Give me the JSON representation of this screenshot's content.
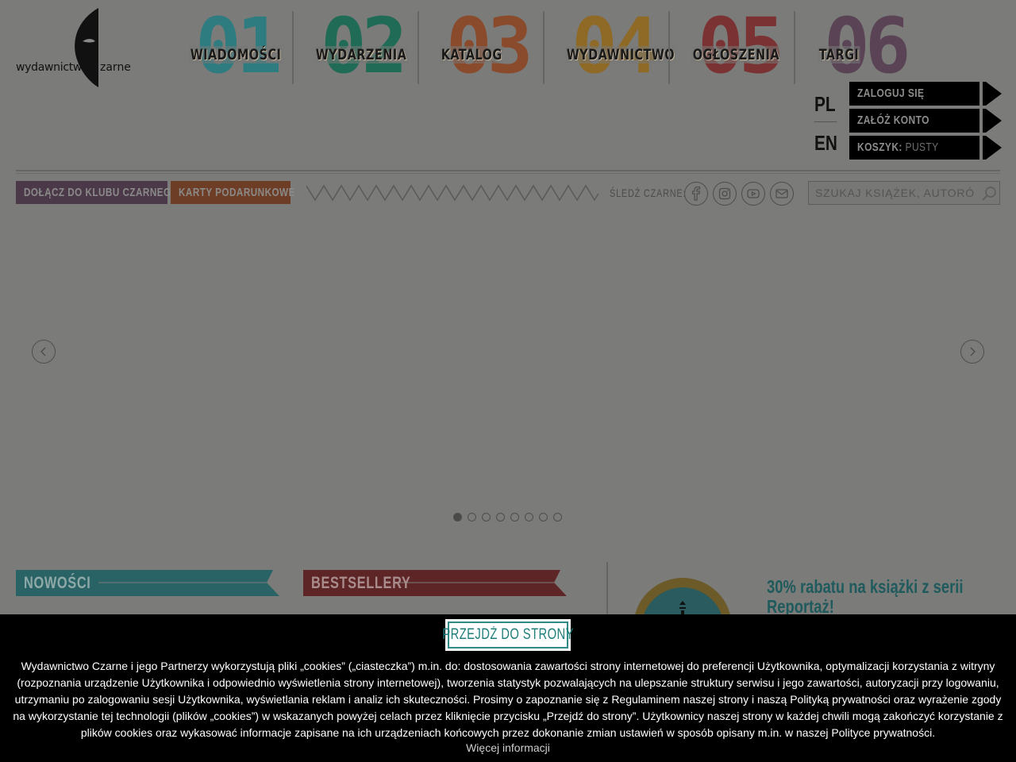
{
  "logo": {
    "text_left": "wydawnictwo",
    "text_right": "zarne"
  },
  "nav": [
    {
      "num": "01",
      "label": "WIADOMOŚCI",
      "color": "#2e7c80"
    },
    {
      "num": "02",
      "label": "WYDARZENIA",
      "color": "#1f6b55"
    },
    {
      "num": "03",
      "label": "KATALOG",
      "color": "#8a4a2c"
    },
    {
      "num": "04",
      "label": "WYDAWNICTWO",
      "color": "#8f6a26"
    },
    {
      "num": "05",
      "label": "OGŁOSZENIA",
      "color": "#7a3233"
    },
    {
      "num": "06",
      "label": "TARGI",
      "color": "#5a4354"
    }
  ],
  "lang": {
    "pl": "PL",
    "en": "EN"
  },
  "account": {
    "login": "ZALOGUJ SIĘ",
    "register": "ZAŁÓŻ KONTO",
    "cart_label": "KOSZYK:",
    "cart_value": "PUSTY"
  },
  "toolbar": {
    "club": "DOŁĄCZ DO KLUBU CZARNEGO",
    "gift_cards": "KARTY PODARUNKOWE",
    "follow": "ŚLEDŹ CZARNE:"
  },
  "social_icons": [
    "facebook-icon",
    "instagram-icon",
    "youtube-icon",
    "mail-icon"
  ],
  "search": {
    "placeholder": "SZUKAJ KSIĄŻEK, AUTORÓW..."
  },
  "slider": {
    "dots": 8,
    "active": 0
  },
  "sections": {
    "new": "NOWOŚCI",
    "bestsellers": "BESTSELLERY",
    "promo": "30% rabatu na książki z serii Reportaż!",
    "promo_line1": "30% rabatu na książki z serii",
    "promo_line2": "Reportaż!"
  },
  "cookie": {
    "button": "PRZEJDŹ DO STRONY",
    "text": "Wydawnictwo Czarne i jego Partnerzy wykorzystują pliki „cookies” („ciasteczka”) m.in. do: dostosowania zawartości strony internetowej do preferencji Użytkownika, optymalizacji korzystania z witryny (rozpoznania urządzenie Użytkownika i odpowiednio wyświetlenia strony internetowej), tworzenia statystyk pozwalających na ulepszanie struktury serwisu i jego zawartości, autoryzacji przy logowaniu, utrzymaniu po zalogowaniu sesji Użytkownika, wyświetlania reklam i analiz ich skuteczności. Prosimy o zapoznanie się z Regulaminem naszej strony i naszą Polityką prywatności oraz wyrażenie zgody na wykorzystanie tej technologii (plików „cookies”) w wskazanych powyżej celach przez kliknięcie przycisku „Przejdź do strony”. Użytkownicy naszej strony w każdej chwili mogą zakończyć korzystanie z plików cookies oraz wykasować informacje zapisane na ich urządzeniach końcowych przez dokonanie zmian ustawień w sposób opisany m.in. w naszej Polityce prywatności.",
    "more": "Więcej informacji"
  },
  "colors": {
    "overlay_bg": "#7b7b79",
    "club": "#4b394a",
    "gift": "#6e3d26",
    "new_banner": "#2a6366",
    "best_banner": "#5e2526",
    "cookie_btn_text": "#1e7e7a"
  }
}
